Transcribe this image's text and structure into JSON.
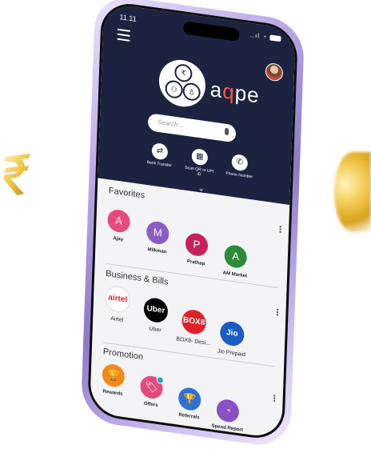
{
  "status": {
    "time": "11.11",
    "signal": "..ıl"
  },
  "brand": {
    "name_pre": "a",
    "name_o": "q",
    "name_post": "pe"
  },
  "search": {
    "placeholder": "Search..."
  },
  "quick_actions": [
    {
      "label": "Bank Transfer",
      "icon": "bank-transfer-icon"
    },
    {
      "label": "Scan QR or UPI ID",
      "icon": "qr-scan-icon"
    },
    {
      "label": "Phone Number",
      "icon": "phone-icon"
    }
  ],
  "favorites": {
    "title": "Favorites",
    "items": [
      {
        "initial": "A",
        "name": "Ajay",
        "color": "#e84a7d"
      },
      {
        "initial": "M",
        "name": "Milkman",
        "color": "#8b5bc7"
      },
      {
        "initial": "P",
        "name": "Prathap",
        "color": "#c8215b"
      },
      {
        "initial": "A",
        "name": "AM Market",
        "color": "#2e8b3a"
      }
    ]
  },
  "business": {
    "title": "Business & Bills",
    "items": [
      {
        "mark": "airtel",
        "name": "Airtel",
        "bg": "#ffffff",
        "fg": "#e2202a"
      },
      {
        "mark": "Uber",
        "name": "Uber",
        "bg": "#000000",
        "fg": "#ffffff"
      },
      {
        "mark": "BOX8",
        "name": "BOX8- Desi...",
        "bg": "#e2202a",
        "fg": "#ffffff"
      },
      {
        "mark": "Jio",
        "name": "Jio Prepaid",
        "bg": "#1b5cc4",
        "fg": "#ffffff"
      }
    ]
  },
  "promotion": {
    "title": "Promotion",
    "items": [
      {
        "glyph": "🏆",
        "name": "Rewards",
        "color": "#f28a1a"
      },
      {
        "glyph": "🏷",
        "name": "Offers",
        "color": "#e34b7d"
      },
      {
        "glyph": "🏆",
        "name": "Referrals",
        "color": "#2e6fd8"
      },
      {
        "glyph": "◔",
        "name": "Spend Report",
        "color": "#8b4fc6"
      }
    ]
  },
  "more_glyph": "⋮",
  "chevron_glyph": "⌄"
}
